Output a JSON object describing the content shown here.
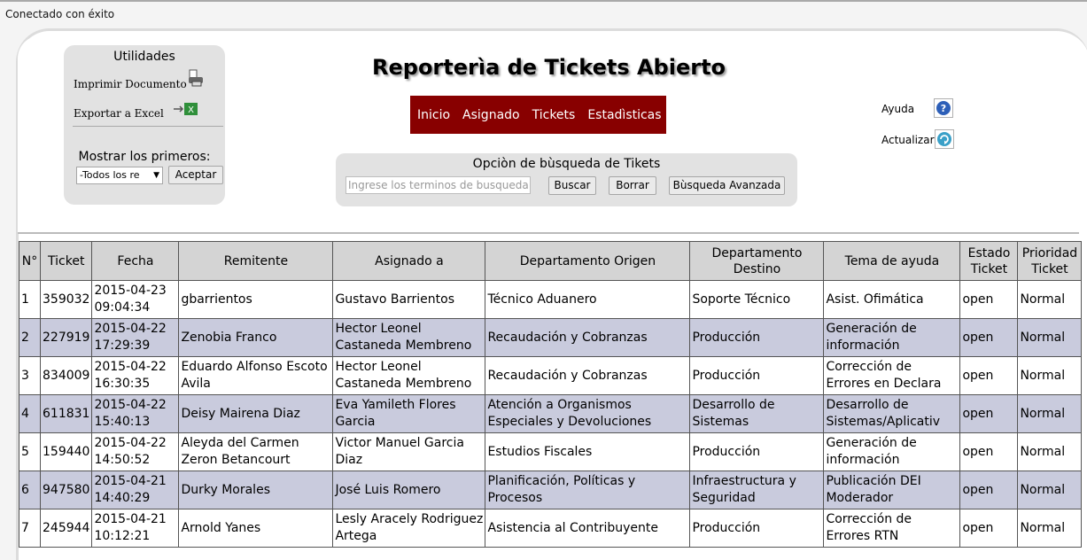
{
  "status_text": "Conectado con éxito",
  "utilidades": {
    "title": "Utilidades",
    "print_label": "Imprimir Documento",
    "excel_label": "Exportar a Excel",
    "show_first_label": "Mostrar los primeros:",
    "select_value": "-Todos los re",
    "accept_label": "Aceptar"
  },
  "page_title": "Reporterìa de Tickets Abierto",
  "nav": [
    "Inicio",
    "Asignado",
    "Tickets",
    "Estadìsticas"
  ],
  "search": {
    "title": "Opciòn de bùsqueda de Tikets",
    "placeholder": "Ingrese los terminos de busqueda",
    "buscar": "Buscar",
    "borrar": "Borrar",
    "avanzada": "Bùsqueda Avanzada"
  },
  "side": {
    "ayuda": "Ayuda",
    "actualizar": "Actualizar"
  },
  "table": {
    "headers": [
      "N°",
      "Ticket",
      "Fecha",
      "Remitente",
      "Asignado a",
      "Departamento Origen",
      "Departamento Destino",
      "Tema de ayuda",
      "Estado Ticket",
      "Prioridad Ticket"
    ],
    "rows": [
      [
        "1",
        "359032",
        "2015-04-23 09:04:34",
        "gbarrientos",
        "Gustavo Barrientos",
        "Técnico Aduanero",
        "Soporte Técnico",
        "Asist. Ofimática",
        "open",
        "Normal"
      ],
      [
        "2",
        "227919",
        "2015-04-22 17:29:39",
        "Zenobia Franco",
        "Hector Leonel Castaneda Membreno",
        "Recaudación y Cobranzas",
        "Producción",
        "Generación de información",
        "open",
        "Normal"
      ],
      [
        "3",
        "834009",
        "2015-04-22 16:30:35",
        "Eduardo Alfonso Escoto Avila",
        "Hector Leonel Castaneda Membreno",
        "Recaudación y Cobranzas",
        "Producción",
        "Corrección de Errores en Declara",
        "open",
        "Normal"
      ],
      [
        "4",
        "611831",
        "2015-04-22 15:40:13",
        "Deisy Mairena Diaz",
        "Eva Yamileth Flores Garcia",
        "Atención a Organismos Especiales y Devoluciones",
        "Desarrollo de Sistemas",
        "Desarrollo de Sistemas/Aplicativ",
        "open",
        "Normal"
      ],
      [
        "5",
        "159440",
        "2015-04-22 14:50:52",
        "Aleyda del Carmen Zeron Betancourt",
        "Victor Manuel Garcia Diaz",
        "Estudios Fiscales",
        "Producción",
        "Generación de información",
        "open",
        "Normal"
      ],
      [
        "6",
        "947580",
        "2015-04-21 14:40:29",
        "Durky Morales",
        "José Luis Romero",
        "Planificación, Políticas y Procesos",
        "Infraestructura y Seguridad",
        "Publicación DEI Moderador",
        "open",
        "Normal"
      ],
      [
        "7",
        "245944",
        "2015-04-21 10:12:21",
        "Arnold Yanes",
        "Lesly Aracely Rodriguez Artega",
        "Asistencia al Contribuyente",
        "Producción",
        "Corrección de Errores RTN",
        "open",
        "Normal"
      ]
    ]
  }
}
